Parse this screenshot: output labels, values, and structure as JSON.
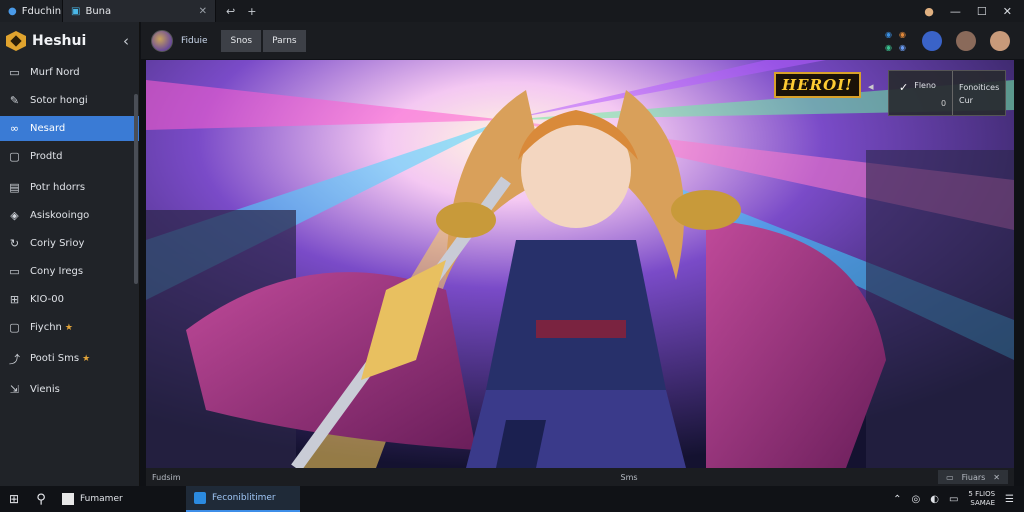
{
  "titlebar": {
    "tabs": [
      {
        "label": "Fduchin",
        "icon": "globe-icon"
      },
      {
        "label": "Buna",
        "icon": "browser-tab-icon"
      }
    ],
    "actions": [
      "↩",
      "+"
    ],
    "window_controls": [
      "—",
      "☐",
      "✕"
    ]
  },
  "sidebar": {
    "brand": "Heshui",
    "collapse_glyph": "‹",
    "items": [
      {
        "label": "Murf Nord",
        "icon": "photo-icon"
      },
      {
        "label": "Sotor hongi",
        "icon": "edit-icon"
      },
      {
        "label": "Nesard",
        "icon": "link-icon",
        "active": true
      },
      {
        "label": "Prodtd",
        "icon": "video-icon"
      },
      {
        "label": "Potr hdorrs",
        "icon": "doc-icon"
      },
      {
        "label": "Asiskooingo",
        "icon": "shield-icon"
      },
      {
        "label": "Coriy Srioy",
        "icon": "refresh-icon"
      },
      {
        "label": "Cony Iregs",
        "icon": "folder-icon"
      },
      {
        "label": "KIO-00",
        "icon": "box-icon"
      },
      {
        "label": "Fiychn",
        "icon": "panel-icon",
        "star": true
      },
      {
        "label": "Pooti Sms",
        "icon": "share-icon",
        "star": true
      },
      {
        "label": "Vienis",
        "icon": "export-icon"
      }
    ]
  },
  "header": {
    "channel_title": "Fiduie",
    "buttons": [
      "Snos",
      "Parns"
    ]
  },
  "hero": {
    "badge": "HEROI!",
    "overlay": {
      "left_label": "Fleno",
      "left_value": "0",
      "right_line1": "Fonoitices",
      "right_line2": "Cur"
    }
  },
  "status": {
    "left": "Fudsim",
    "middle": "Sms",
    "right": "Fiuars"
  },
  "taskbar": {
    "apps": [
      "Fumamer",
      "Feconiblitimer"
    ],
    "clock_line1": "5 FLIOS",
    "clock_line2": "SAMAE"
  }
}
